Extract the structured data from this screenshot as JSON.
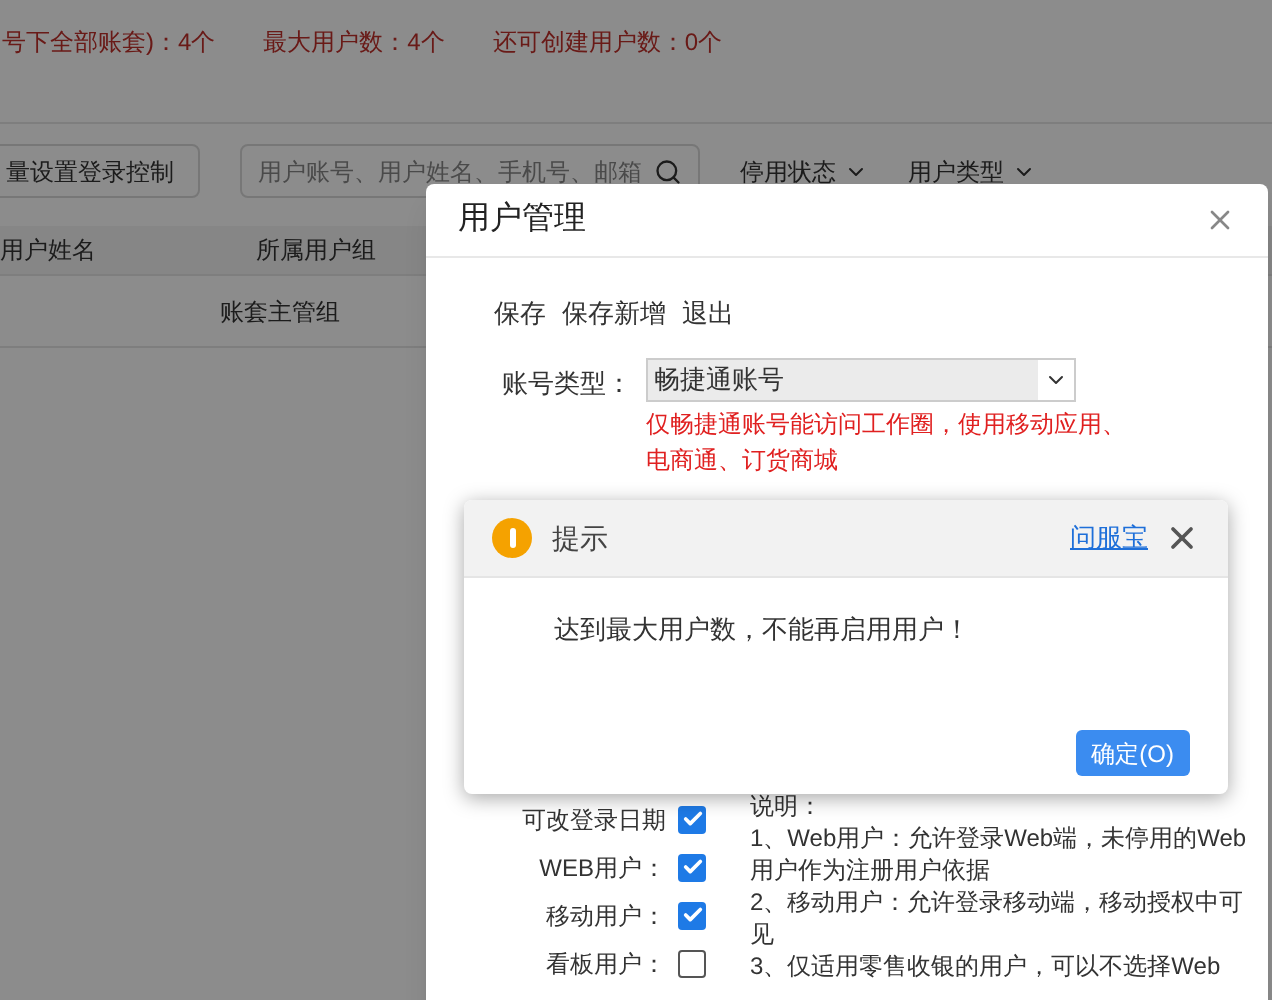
{
  "summary": {
    "items": [
      "号下全部账套)：4个",
      "最大用户数：4个",
      "还可创建用户数：0个"
    ]
  },
  "toolbar": {
    "batch_button": "量设置登录控制",
    "search": {
      "placeholder": "用户账号、用户姓名、手机号、邮箱"
    },
    "filters": [
      "停用状态",
      "用户类型"
    ]
  },
  "table": {
    "columns": [
      "用户姓名",
      "所属用户组"
    ],
    "rows": [
      {
        "group": "账套主管组"
      }
    ]
  },
  "dialog": {
    "title": "用户管理",
    "actions": [
      "保存",
      "保存新增",
      "退出"
    ],
    "account_type": {
      "label": "账号类型：",
      "value": "畅捷通账号",
      "note": "仅畅捷通账号能访问工作圈，使用移动应用、电商通、订货商城"
    },
    "options": [
      {
        "label": "可改登录日期",
        "checked": true
      },
      {
        "label": "WEB用户：",
        "checked": true
      },
      {
        "label": "移动用户：",
        "checked": true
      },
      {
        "label": "看板用户：",
        "checked": false
      }
    ],
    "notes": [
      "说明：",
      "1、Web用户：允许登录Web端，未停用的Web用户作为注册用户依据",
      "2、移动用户：允许登录移动端，移动授权中可见",
      "3、仅适用零售收银的用户，可以不选择Web"
    ]
  },
  "alert": {
    "title": "提示",
    "help_link": "问服宝",
    "message": "达到最大用户数，不能再启用用户！",
    "ok_button": "确定(O)"
  }
}
